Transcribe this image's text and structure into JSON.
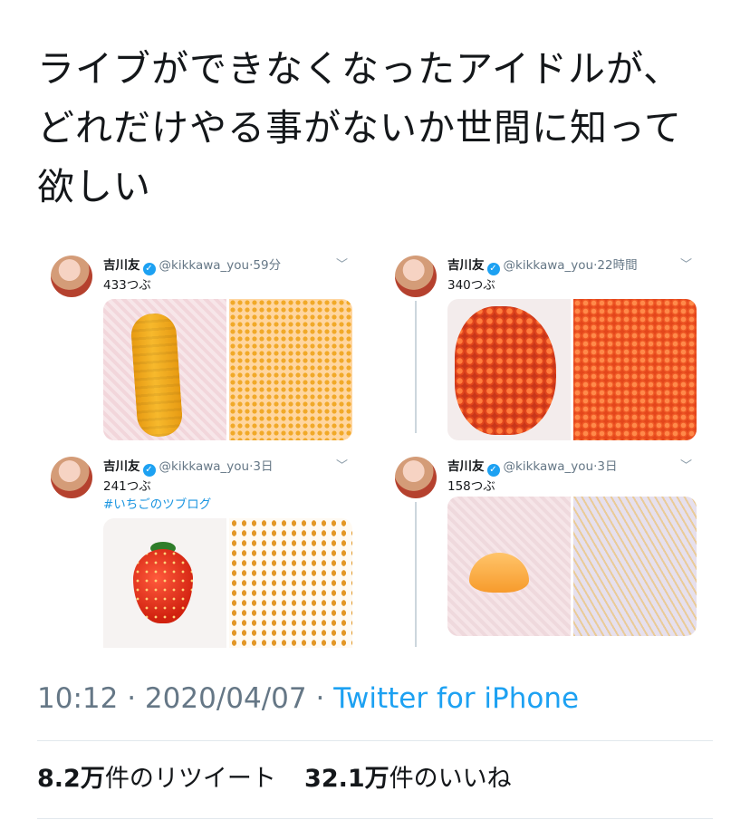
{
  "tweet": {
    "text": "ライブができなくなったアイドルが、\nどれだけやる事がないか世間に知って\n欲しい"
  },
  "embedded_tweets": [
    {
      "author": "吉川友",
      "handle": "@kikkawa_you",
      "time": "59分",
      "count_text": "433つぶ",
      "hashtag": "",
      "photos": [
        "corn-whole",
        "corn-kernels"
      ]
    },
    {
      "author": "吉川友",
      "handle": "@kikkawa_you",
      "time": "22時間",
      "count_text": "340つぶ",
      "hashtag": "",
      "photos": [
        "salmon-roe-pile",
        "salmon-roe-spread"
      ]
    },
    {
      "author": "吉川友",
      "handle": "@kikkawa_you",
      "time": "3日",
      "count_text": "241つぶ",
      "hashtag": "#いちごのツブログ",
      "photos": [
        "strawberry-whole",
        "strawberry-seeds"
      ]
    },
    {
      "author": "吉川友",
      "handle": "@kikkawa_you",
      "time": "3日",
      "count_text": "158つぶ",
      "hashtag": "",
      "photos": [
        "mandarin-segment",
        "mandarin-pulp"
      ]
    }
  ],
  "meta": {
    "time": "10:12",
    "date": "2020/04/07",
    "separator": "·",
    "source": "Twitter for iPhone"
  },
  "stats": {
    "retweets_num": "8.2万",
    "retweets_label": "件のリツイート",
    "likes_num": "32.1万",
    "likes_label": "件のいいね"
  },
  "icons": {
    "verified": "verified-badge-icon",
    "chevron": "chevron-down-icon"
  },
  "colors": {
    "link": "#1da1f2",
    "muted": "#657786",
    "text": "#14171a",
    "divider": "#e1e8ed"
  }
}
